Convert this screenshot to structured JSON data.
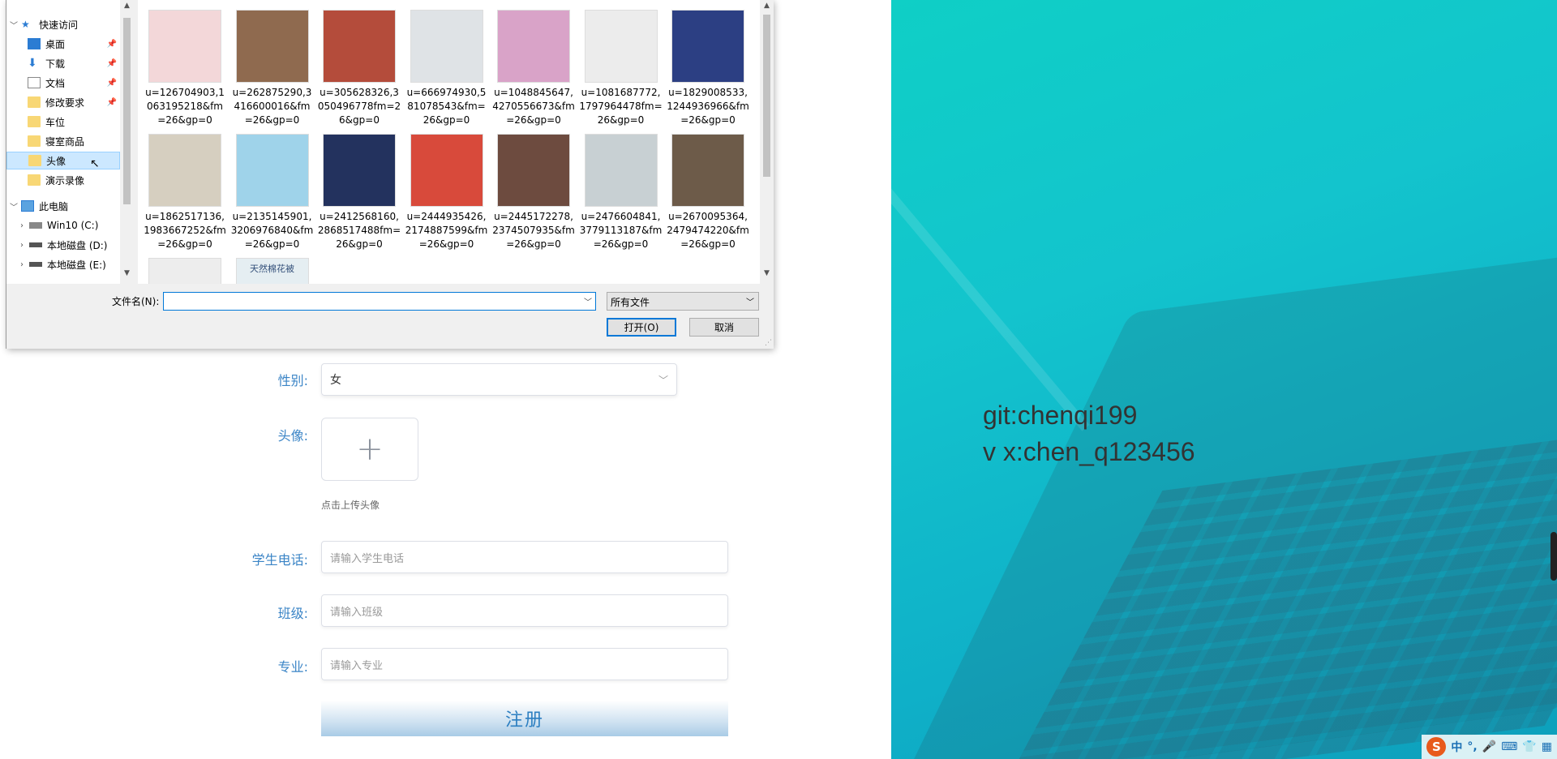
{
  "dialog": {
    "nav": {
      "quick_access": "快速访问",
      "items": [
        "桌面",
        "下载",
        "文档",
        "修改要求",
        "车位",
        "寝室商品",
        "头像",
        "演示录像"
      ],
      "this_pc": "此电脑",
      "drives": [
        "Win10 (C:)",
        "本地磁盘 (D:)",
        "本地磁盘 (E:)"
      ]
    },
    "files": [
      {
        "name": "u=126704903,1063195218&fm=26&gp=0",
        "color": "#f3d7d9"
      },
      {
        "name": "u=262875290,3416600016&fm=26&gp=0",
        "color": "#8f6a4f"
      },
      {
        "name": "u=305628326,3050496778fm=26&gp=0",
        "color": "#b44c3b"
      },
      {
        "name": "u=666974930,581078543&fm=26&gp=0",
        "color": "#dfe3e6"
      },
      {
        "name": "u=1048845647,4270556673&fm=26&gp=0",
        "color": "#d9a3c8"
      },
      {
        "name": "u=1081687772,1797964478fm=26&gp=0",
        "color": "#ececec"
      },
      {
        "name": "u=1829008533,1244936966&fm=26&gp=0",
        "color": "#2c3f83"
      },
      {
        "name": "u=1862517136,1983667252&fm=26&gp=0",
        "color": "#d6cfc0"
      },
      {
        "name": "u=2135145901,3206976840&fm=26&gp=0",
        "color": "#9fd3ea"
      },
      {
        "name": "u=2412568160,2868517488fm=26&gp=0",
        "color": "#23325e"
      },
      {
        "name": "u=2444935426,2174887599&fm=26&gp=0",
        "color": "#d84a3b"
      },
      {
        "name": "u=2445172278,2374507935&fm=26&gp=0",
        "color": "#6d4b3f"
      },
      {
        "name": "u=2476604841,3779113187&fm=26&gp=0",
        "color": "#c8d0d3"
      },
      {
        "name": "u=2670095364,2479474220&fm=26&gp=0",
        "color": "#6d5b49"
      },
      {
        "name": "",
        "color": "#ededed"
      },
      {
        "name": "",
        "color": "#e5eef2",
        "caption": "天然棉花被"
      }
    ],
    "filename_label": "文件名(N):",
    "filename_value": "",
    "filetype": "所有文件",
    "open_label": "打开(O)",
    "cancel_label": "取消"
  },
  "form": {
    "gender_label": "性别:",
    "gender_value": "女",
    "avatar_label": "头像:",
    "upload_hint": "点击上传头像",
    "phone_label": "学生电话:",
    "phone_placeholder": "请输入学生电话",
    "class_label": "班级:",
    "class_placeholder": "请输入班级",
    "major_label": "专业:",
    "major_placeholder": "请输入专业",
    "register_label": "注册"
  },
  "side": {
    "line1": "git:chenqi199",
    "line2": "v x:chen_q123456"
  },
  "taskbar": {
    "ime": "中"
  }
}
